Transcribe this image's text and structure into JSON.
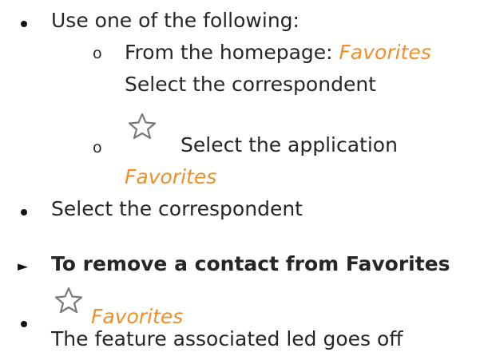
{
  "items": {
    "use_one": "Use one of the following:",
    "option1_prefix": "From the homepage: ",
    "option1_link": "Favorites",
    "option1_line2": "Select the correspondent",
    "option2_text": "Select the application",
    "option2_link": "Favorites",
    "select_correspondent": "Select the correspondent",
    "section_heading": "To remove a contact from Favorites",
    "remove_link": "Favorites",
    "remove_result": "The feature associated led goes off"
  },
  "glyphs": {
    "sub_bullet": "o",
    "section_arrow": "►"
  },
  "icons": {
    "star": "star-outline-icon"
  },
  "colors": {
    "text": "#262626",
    "accent": "#ef8f2a"
  }
}
